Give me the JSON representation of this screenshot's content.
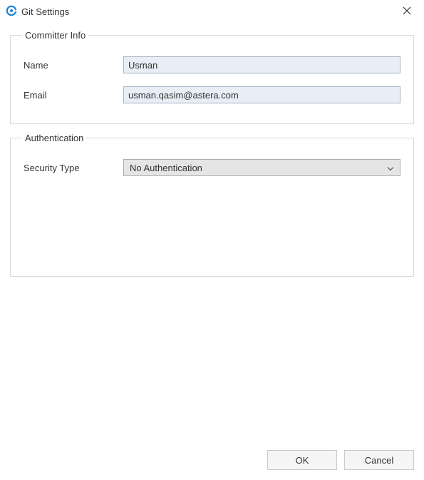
{
  "window": {
    "title": "Git Settings"
  },
  "committer": {
    "legend": "Committer Info",
    "nameLabel": "Name",
    "nameValue": "Usman",
    "emailLabel": "Email",
    "emailValue": "usman.qasim@astera.com"
  },
  "auth": {
    "legend": "Authentication",
    "securityTypeLabel": "Security Type",
    "securityTypeValue": "No Authentication"
  },
  "buttons": {
    "ok": "OK",
    "cancel": "Cancel"
  }
}
